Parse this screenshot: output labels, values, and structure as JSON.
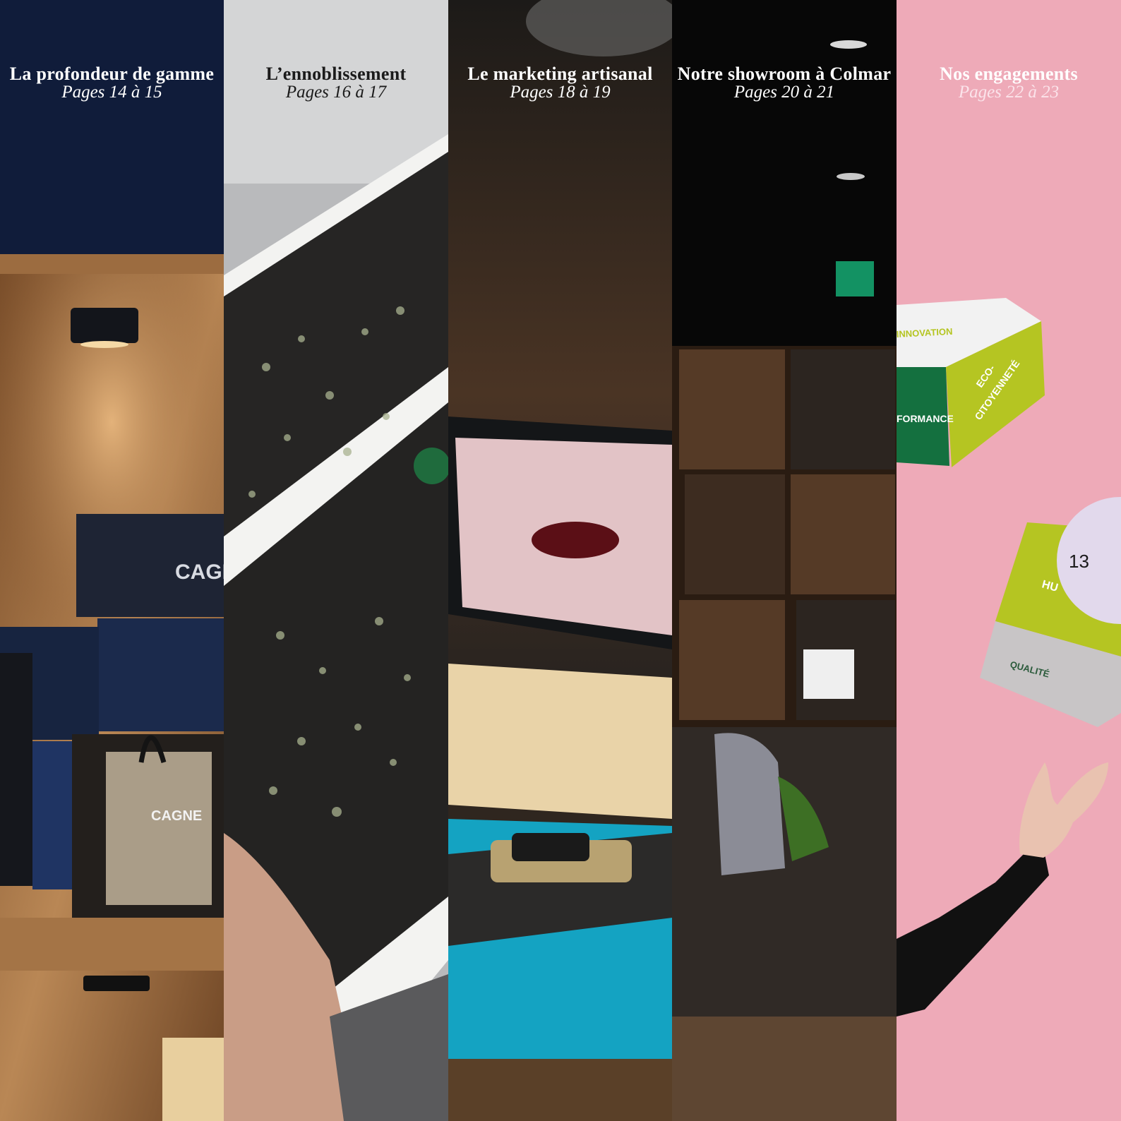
{
  "sections": [
    {
      "title": "La profondeur de gamme",
      "pages": "Pages 14 à 15"
    },
    {
      "title": "L’ennoblissement",
      "pages": "Pages 16 à 17"
    },
    {
      "title": "Le marketing artisanal",
      "pages": "Pages 18 à 19"
    },
    {
      "title": "Notre showroom à Colmar",
      "pages": "Pages 20 à 21"
    },
    {
      "title": "Nos engagements",
      "pages": "Pages 22 à 23"
    }
  ],
  "photo_labels": {
    "brand_box": "CAGN",
    "brand_bag": "CAGNE",
    "cube_top": "INNOVATION",
    "cube_left": "FORMANCE",
    "cube_right_1": "ECO-",
    "cube_right_2": "CITOYENNETÉ",
    "cube2_front": "HU",
    "cube2_side": "QUALITÉ"
  },
  "page_number": "13",
  "colors": {
    "navy": "#101c3a",
    "wood": "#8a5a32",
    "pink": "#eeaab8",
    "lime": "#b5c522",
    "green": "#14703f",
    "badge": "#e2d9ec"
  }
}
